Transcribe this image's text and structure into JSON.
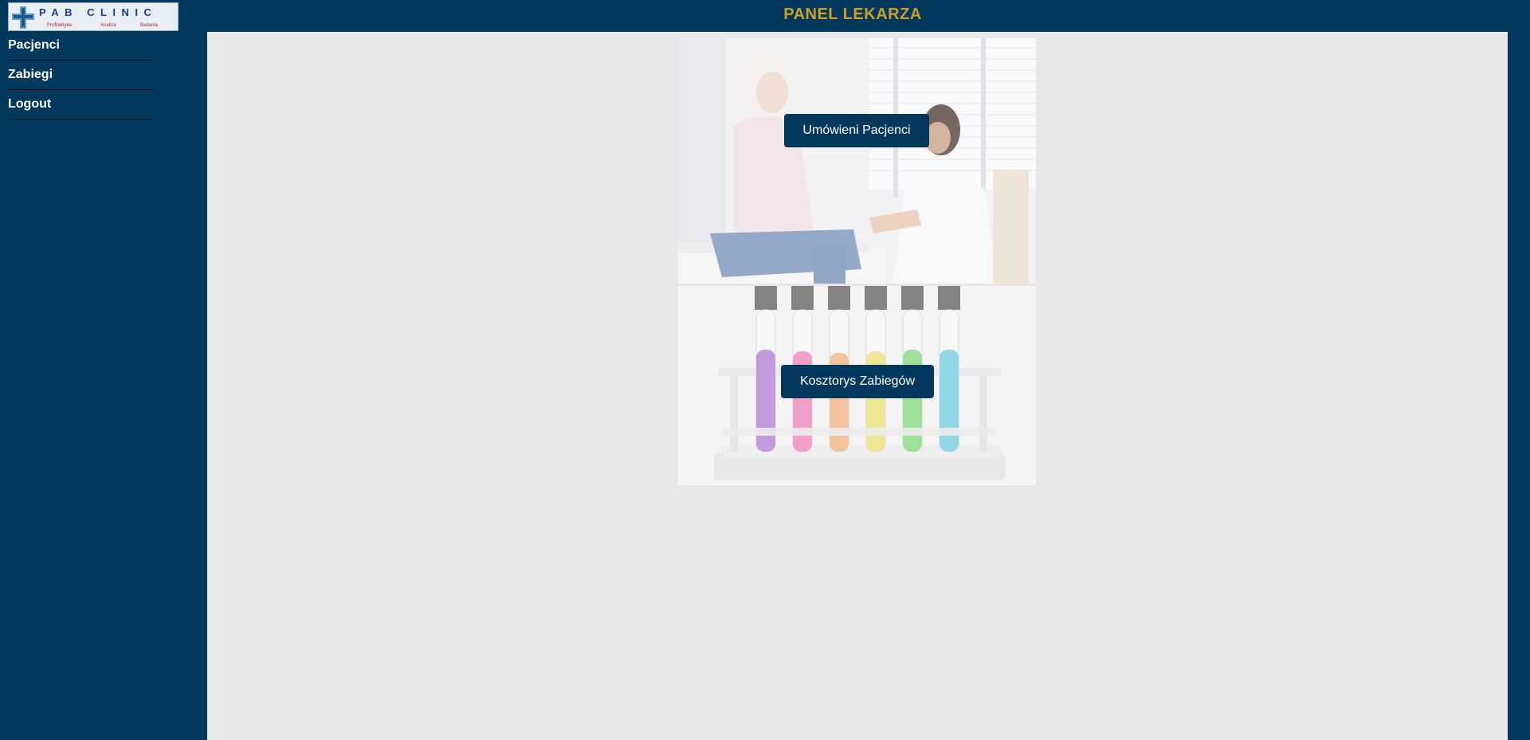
{
  "logo": {
    "brand": "PAB CLINIC",
    "taglines": [
      "Profilaktyka",
      "Analiza",
      "Badania"
    ],
    "icon": "medical-cross-icon"
  },
  "header": {
    "title": "PANEL LEKARZA"
  },
  "sidebar": {
    "items": [
      {
        "label": "Pacjenci"
      },
      {
        "label": "Zabiegi"
      },
      {
        "label": "Logout"
      }
    ]
  },
  "main": {
    "tiles": [
      {
        "button_label": "Umówieni Pacjenci",
        "image": "doctor-patient-consultation-photo"
      },
      {
        "button_label": "Kosztorys Zabiegów",
        "image": "test-tubes-rack-photo"
      }
    ]
  },
  "colors": {
    "background": "#01385c",
    "accent_title": "#c9a227",
    "content_bg": "#e7e7e7",
    "button_bg": "#01385c",
    "text_light": "#ffffff"
  }
}
